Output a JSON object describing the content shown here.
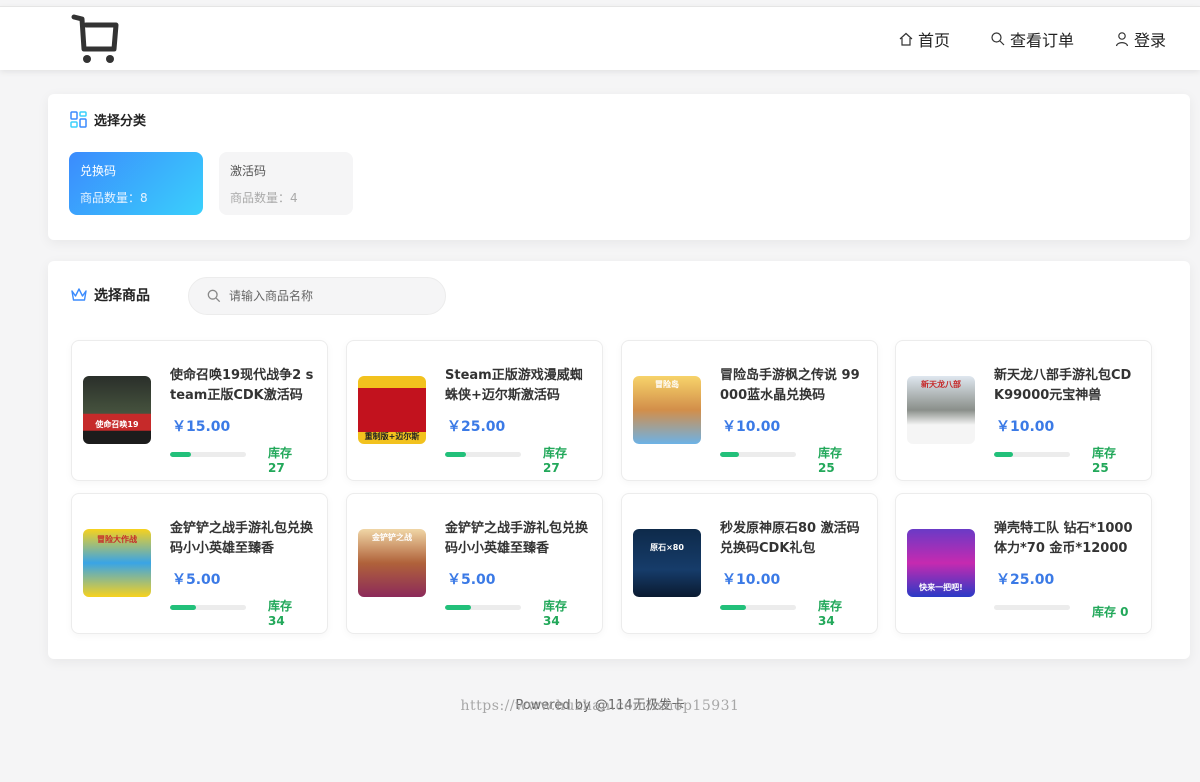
{
  "header": {
    "nav": [
      {
        "label": "首页",
        "icon": "home-icon"
      },
      {
        "label": "查看订单",
        "icon": "search-icon"
      },
      {
        "label": "登录",
        "icon": "user-icon"
      }
    ]
  },
  "category": {
    "title": "选择分类",
    "items": [
      {
        "name": "兑换码",
        "count": "商品数量：8"
      },
      {
        "name": "激活码",
        "count": "商品数量：4"
      }
    ]
  },
  "products": {
    "title": "选择商品",
    "search_placeholder": "请输入商品名称",
    "items": [
      {
        "name": "使命召唤19现代战争2 steam正版CDK激活码",
        "price": "￥15.00",
        "stock_label": "库存",
        "stock": "27",
        "stock_level": 0.27,
        "thumb_text": "使命召唤19"
      },
      {
        "name": "Steam正版游戏漫威蜘蛛侠+迈尔斯激活码",
        "price": "￥25.00",
        "stock_label": "库存",
        "stock": "27",
        "stock_level": 0.27,
        "thumb_text": "重制版+迈尔斯"
      },
      {
        "name": "冒险岛手游枫之传说 99000蓝水晶兑换码",
        "price": "￥10.00",
        "stock_label": "库存",
        "stock": "25",
        "stock_level": 0.25,
        "thumb_text": "冒险岛"
      },
      {
        "name": "新天龙八部手游礼包CDK99000元宝神兽",
        "price": "￥10.00",
        "stock_label": "库存",
        "stock": "25",
        "stock_level": 0.25,
        "thumb_text": "新天龙八部"
      },
      {
        "name": "金铲铲之战手游礼包兑换码小小英雄至臻香",
        "price": "￥5.00",
        "stock_label": "库存",
        "stock": "34",
        "stock_level": 0.34,
        "thumb_text": "冒险大作战"
      },
      {
        "name": "金铲铲之战手游礼包兑换码小小英雄至臻香",
        "price": "￥5.00",
        "stock_label": "库存",
        "stock": "34",
        "stock_level": 0.34,
        "thumb_text": "金铲铲之战"
      },
      {
        "name": "秒发原神原石80 激活码兑换码CDK礼包",
        "price": "￥10.00",
        "stock_label": "库存",
        "stock": "34",
        "stock_level": 0.34,
        "thumb_text": "原石×80"
      },
      {
        "name": "弹壳特工队 钻石*1000体力*70 金币*12000",
        "price": "￥25.00",
        "stock_label": "库存 0",
        "stock": "",
        "stock_level": 0,
        "thumb_text": "快来一把吧!"
      }
    ]
  },
  "footer": {
    "powered": "Powered by @114无极发卡",
    "watermark": "https://www.huzhan.com/ishop15931"
  },
  "colors": {
    "accent": "#3b7ae6",
    "stock": "#22a85a",
    "active_tile_start": "#3b8bfd",
    "active_tile_end": "#3ad0fc"
  }
}
